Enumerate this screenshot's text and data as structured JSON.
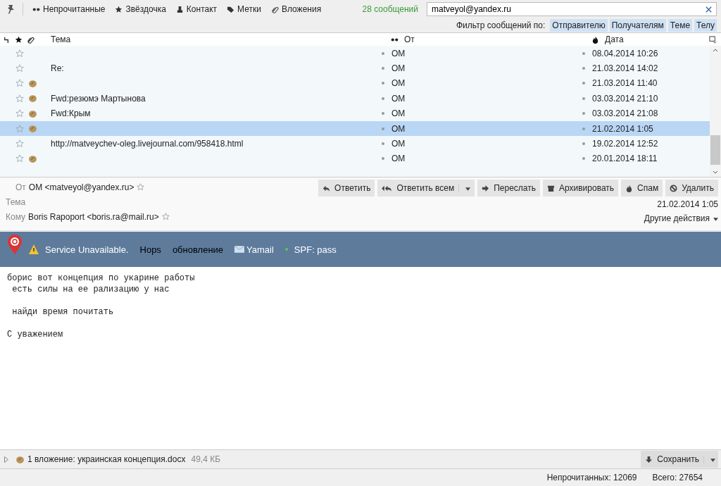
{
  "quick_filter": {
    "buttons": [
      {
        "label": "Непрочитанные",
        "kind": "unread"
      },
      {
        "label": "Звёздочка",
        "kind": "star"
      },
      {
        "label": "Контакт",
        "kind": "contact"
      },
      {
        "label": "Метки",
        "kind": "tag"
      },
      {
        "label": "Вложения",
        "kind": "attachment"
      }
    ],
    "count": "28 сообщений",
    "search": {
      "value": "matveyol@yandex.ru"
    },
    "filter_label": "Фильтр сообщений по:",
    "filter_by": [
      {
        "label": "Отправителю",
        "selected": true
      },
      {
        "label": "Получателям",
        "selected": true
      },
      {
        "label": "Теме",
        "selected": true
      },
      {
        "label": "Телу",
        "selected": true
      }
    ]
  },
  "table": {
    "columns": {
      "subject": "Тема",
      "from": "От",
      "date": "Дата"
    },
    "rows": [
      {
        "starred": false,
        "attachment": false,
        "subject": "",
        "from": "OM",
        "date": "08.04.2014 10:26",
        "selected": false
      },
      {
        "starred": false,
        "attachment": false,
        "subject": "Re:",
        "from": "OM",
        "date": "21.03.2014 14:02",
        "selected": false
      },
      {
        "starred": false,
        "attachment": true,
        "subject": "",
        "from": "OM",
        "date": "21.03.2014 11:40",
        "selected": false
      },
      {
        "starred": false,
        "attachment": true,
        "subject": "Fwd:резюмэ Мартынова",
        "from": "OM",
        "date": "03.03.2014 21:10",
        "selected": false
      },
      {
        "starred": false,
        "attachment": true,
        "subject": "Fwd:Крым",
        "from": "OM",
        "date": "03.03.2014 21:08",
        "selected": false
      },
      {
        "starred": false,
        "attachment": true,
        "subject": "",
        "from": "OM",
        "date": "21.02.2014 1:05",
        "selected": true
      },
      {
        "starred": false,
        "attachment": false,
        "subject": "http://matveychev-oleg.livejournal.com/958418.html",
        "from": "OM",
        "date": "19.02.2014 12:52",
        "selected": false
      },
      {
        "starred": false,
        "attachment": true,
        "subject": "",
        "from": "OM",
        "date": "20.01.2014 18:11",
        "selected": false
      }
    ]
  },
  "message": {
    "from_label": "От",
    "from": "OM <matveyol@yandex.ru>",
    "subject_label": "Тема",
    "to_label": "Кому",
    "to": "Boris Rapoport <boris.ra@mail.ru>",
    "actions": [
      {
        "label": "Ответить",
        "kind": "reply"
      },
      {
        "label": "Ответить всем",
        "kind": "reply-all"
      },
      {
        "label": "Переслать",
        "kind": "forward"
      },
      {
        "label": "Архивировать",
        "kind": "archive"
      },
      {
        "label": "Спам",
        "kind": "spam"
      },
      {
        "label": "Удалить",
        "kind": "delete"
      }
    ],
    "date": "21.02.2014 1:05",
    "more": "Другие действия",
    "banner": {
      "warning": "Service Unavailable.",
      "hops": "Hops",
      "update": "обновление",
      "mailer": "Yamail",
      "spf": "SPF: pass"
    },
    "body": "борис вот концепция по укарине работы\n есть силы на ее рализацию у нас\n\n найди время почитать\n\nС уважением",
    "attachment": {
      "summary": "1 вложение: украинская концепция.docx",
      "size": "49,4 КБ",
      "save": "Сохранить"
    }
  },
  "status_bar": {
    "unread": "Непрочитанных: 12069",
    "total": "Всего: 27654"
  }
}
